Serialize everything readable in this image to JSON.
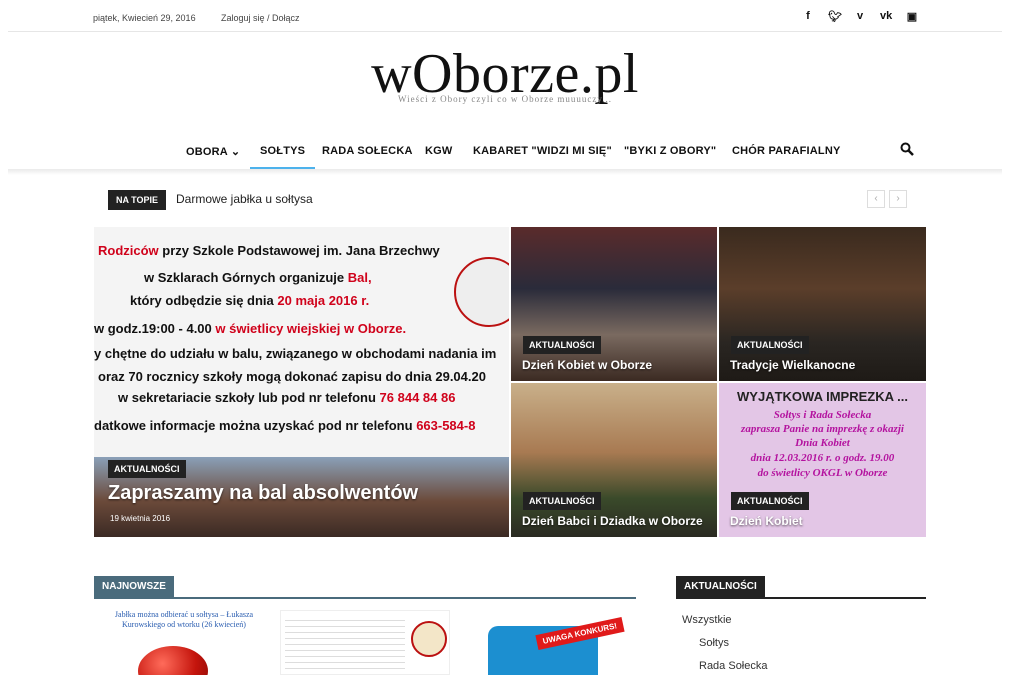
{
  "topbar": {
    "date": "piątek, Kwiecień 29, 2016",
    "login": "Zaloguj się / Dołącz",
    "social_icons": [
      "facebook-icon",
      "twitter-icon",
      "vimeo-icon",
      "vk-icon",
      "youtube-icon"
    ]
  },
  "logo": {
    "title": "wOborze.pl",
    "tagline": "Wieści z Obory czyli co w Oborze muuuuczy..."
  },
  "menu": {
    "items": [
      "OBORA",
      "SOŁTYS",
      "RADA SOŁECKA",
      "KGW",
      "KABARET \"WIDZI MI SIĘ\"",
      "\"BYKI Z OBORY\"",
      "CHÓR PARAFIALNY"
    ],
    "active": "SOŁTYS",
    "dropdown_glyph": "⌄",
    "accent": "#4db2ec"
  },
  "trending": {
    "tag": "NA TOPIE",
    "text": "Darmowe jabłka u sołtysa"
  },
  "featured": {
    "big": {
      "category": "AKTUALNOŚCI",
      "title": "Zapraszamy na bal absolwentów",
      "date": "19 kwietnia 2016",
      "poster_lines": {
        "l1a": "Rodziców",
        "l1b": " przy Szkole Podstawowej im. Jana Brzechwy",
        "l2a": "w Szklarach Górnych organizuje ",
        "l2b": "Bal,",
        "l3a": "który odbędzie się dnia ",
        "l3b": "20 maja 2016 r.",
        "l4a": "w godz.19:00 - 4.00 ",
        "l4b": "w świetlicy wiejskiej w Oborze.",
        "l5": "y chętne do udziału w balu, związanego w obchodami nadania im",
        "l6": "oraz 70 rocznicy szkoły mogą dokonać zapisu do dnia 29.04.20",
        "l7a": "w sekretariacie szkoły lub pod nr telefonu ",
        "l7b": "76 844 84 86",
        "l8a": "datkowe informacje można uzyskać pod nr telefonu ",
        "l8b": "663-584-8"
      }
    },
    "tiles": [
      {
        "category": "AKTUALNOŚCI",
        "title": "Dzień Kobiet w Oborze"
      },
      {
        "category": "AKTUALNOŚCI",
        "title": "Tradycje Wielkanocne"
      },
      {
        "category": "AKTUALNOŚCI",
        "title": "Dzień Babci i Dziadka w Oborze"
      },
      {
        "category": "AKTUALNOŚCI",
        "title": "Dzień Kobiet"
      }
    ],
    "tile4_poster": {
      "headline": "WYJĄTKOWA IMPREZKA ...",
      "lines": [
        "Sołtys i Rada Sołecka",
        "zaprasza Panie na imprezkę z okazji",
        "Dnia Kobiet",
        "dnia 12.03.2016 r. o godz. 19.00",
        "do świetlicy OKGL w Oborze"
      ]
    }
  },
  "sections": {
    "latest": {
      "label": "NAJNOWSZE",
      "color": "#4a6b7c"
    },
    "news": {
      "label": "AKTUALNOŚCI",
      "color": "#222222"
    }
  },
  "thumbs": {
    "t1": "Jabłka można odbierać u sołtysa – Łukasza Kurowskiego od wtorku (26 kwiecień)",
    "t3": "UWAGA KONKURS!"
  },
  "sidebar": {
    "items": [
      "Wszystkie",
      "Sołtys",
      "Rada Sołecka"
    ]
  }
}
